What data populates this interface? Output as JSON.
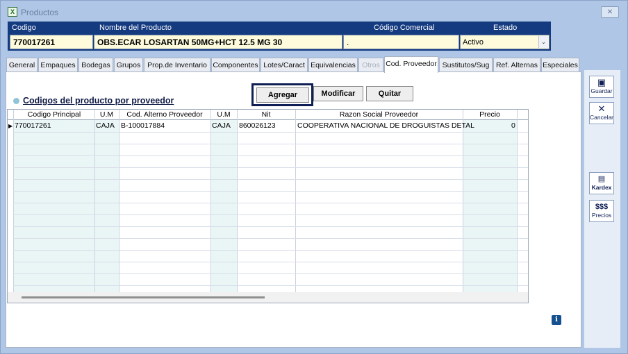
{
  "window": {
    "title": "Productos",
    "close_label": "⨯"
  },
  "header": {
    "codigo_label": "Codigo",
    "nombre_label": "Nombre del Producto",
    "comercial_label": "Código Comercial",
    "estado_label": "Estado",
    "codigo_value": "770017261",
    "nombre_value": "OBS.ECAR LOSARTAN 50MG+HCT 12.5 MG 30",
    "comercial_value": ".",
    "estado_value": "Activo"
  },
  "tabs": [
    {
      "label": "General"
    },
    {
      "label": "Empaques"
    },
    {
      "label": "Bodegas"
    },
    {
      "label": "Grupos"
    },
    {
      "label": "Prop.de Inventario"
    },
    {
      "label": "Componentes"
    },
    {
      "label": "Lotes/Caract"
    },
    {
      "label": "Equivalencias"
    },
    {
      "label": "Otros"
    },
    {
      "label": "Cod. Proveedor"
    },
    {
      "label": "Sustitutos/Sug"
    },
    {
      "label": "Ref. Alternas"
    },
    {
      "label": "Especiales"
    }
  ],
  "section": {
    "title": "Codigos del producto por proveedor"
  },
  "buttons": {
    "agregar": "Agregar",
    "modificar": "Modificar",
    "quitar": "Quitar"
  },
  "table": {
    "columns": [
      "Codigo Principal",
      "U.M",
      "Cod. Alterno  Proveedor",
      "U.M",
      "Nit",
      "Razon Social Proveedor",
      "Precio"
    ],
    "rows": [
      {
        "codigo": "770017261",
        "um1": "CAJA",
        "alterno": "B-100017884",
        "um2": "CAJA",
        "nit": "860026123",
        "razon": "COOPERATIVA NACIONAL DE DROGUISTAS DETAL",
        "precio": "0"
      }
    ]
  },
  "sidebar": {
    "guardar": "Guardar",
    "cancelar": "Cancelar",
    "kardex": "Kardex",
    "precios_symbol": "$$$",
    "precios": "Precios"
  },
  "info_label": "i",
  "colors": {
    "header_bg": "#143a80",
    "window_bg": "#afc6e6",
    "field_bg": "#fdfbdc",
    "grid_shade": "#eaf6f6"
  },
  "icons": {
    "app": "excel-icon",
    "close": "close-icon",
    "save": "floppy-disk-icon",
    "cancel": "x-icon",
    "kardex": "ledger-icon",
    "info": "info-icon"
  }
}
